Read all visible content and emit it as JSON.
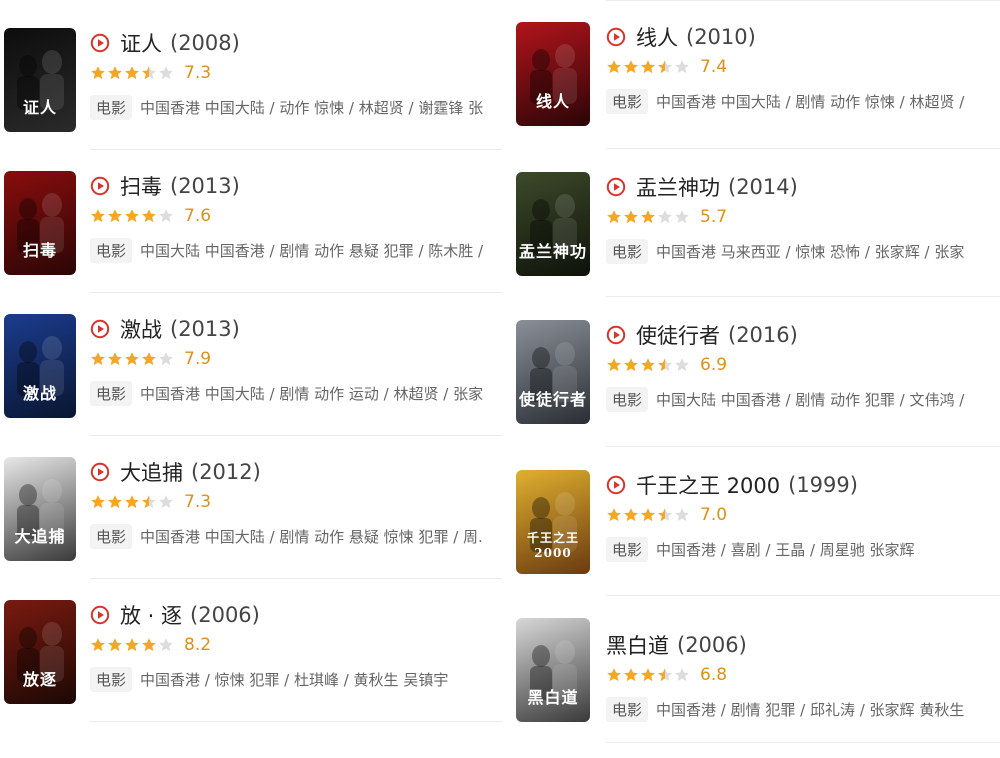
{
  "badge_label": "电影",
  "accent_color": "#d9342b",
  "star_color": "#f5a623",
  "star_empty_color": "#dddddd",
  "left_column": [
    {
      "title": "证人",
      "year": "(2008)",
      "rating": "7.3",
      "stars": 3.5,
      "meta": "中国香港 中国大陆 / 动作 惊悚 / 林超贤 / 谢霆锋 张",
      "poster_text": "证人",
      "poster_colors": [
        "#0d0d0d",
        "#2a2a2a"
      ]
    },
    {
      "title": "扫毒",
      "year": "(2013)",
      "rating": "7.6",
      "stars": 4,
      "meta": "中国大陆 中国香港 / 剧情 动作 悬疑 犯罪 / 陈木胜 /",
      "poster_text": "扫毒",
      "poster_colors": [
        "#8a0d0d",
        "#2a0606"
      ]
    },
    {
      "title": "激战",
      "year": "(2013)",
      "rating": "7.9",
      "stars": 4,
      "meta": "中国香港 中国大陆 / 剧情 动作 运动 / 林超贤 / 张家",
      "poster_text": "激战",
      "poster_colors": [
        "#1b3d8f",
        "#0a1530"
      ]
    },
    {
      "title": "大追捕",
      "year": "(2012)",
      "rating": "7.3",
      "stars": 3.5,
      "meta": "中国香港 中国大陆 / 剧情 动作 悬疑 惊悚 犯罪 / 周.",
      "poster_text": "大追捕",
      "poster_colors": [
        "#e8e8e8",
        "#3a3a3a"
      ]
    },
    {
      "title": "放 · 逐",
      "year": "(2006)",
      "rating": "8.2",
      "stars": 4,
      "meta": "中国香港 / 惊悚 犯罪 / 杜琪峰 / 黄秋生 吴镇宇",
      "poster_text": "放逐",
      "poster_colors": [
        "#7a1a10",
        "#1c0804"
      ]
    }
  ],
  "right_column": [
    {
      "title": "线人",
      "year": "(2010)",
      "rating": "7.4",
      "stars": 3.5,
      "meta": "中国香港 中国大陆 / 剧情 动作 惊悚 / 林超贤 /",
      "poster_text": "线人",
      "poster_colors": [
        "#b3141b",
        "#2a0507"
      ]
    },
    {
      "title": "盂兰神功",
      "year": "(2014)",
      "rating": "5.7",
      "stars": 3,
      "meta": "中国香港 马来西亚 / 惊悚 恐怖 / 张家辉 / 张家",
      "poster_text": "盂兰神功",
      "poster_colors": [
        "#3d4a2a",
        "#0e120a"
      ]
    },
    {
      "title": "使徒行者",
      "year": "(2016)",
      "rating": "6.9",
      "stars": 3.5,
      "meta": "中国大陆 中国香港 / 剧情 动作 犯罪 / 文伟鸿 /",
      "poster_text": "使徒行者",
      "poster_colors": [
        "#8a9098",
        "#2a2e34"
      ]
    },
    {
      "title": "千王之王 2000",
      "year": "(1999)",
      "rating": "7.0",
      "stars": 3.5,
      "meta": "中国香港 / 喜剧 / 王晶 / 周星驰 张家辉",
      "poster_text": "千王之王2000",
      "poster_colors": [
        "#e0b030",
        "#6a3a10"
      ]
    },
    {
      "title": "黑白道",
      "year": "(2006)",
      "rating": "6.8",
      "stars": 3.5,
      "meta": "中国香港 / 剧情 犯罪 / 邱礼涛 / 张家辉 黄秋生",
      "poster_text": "黑白道",
      "poster_colors": [
        "#d8d8d8",
        "#3a3a3a"
      ],
      "no_play_icon": true
    }
  ]
}
